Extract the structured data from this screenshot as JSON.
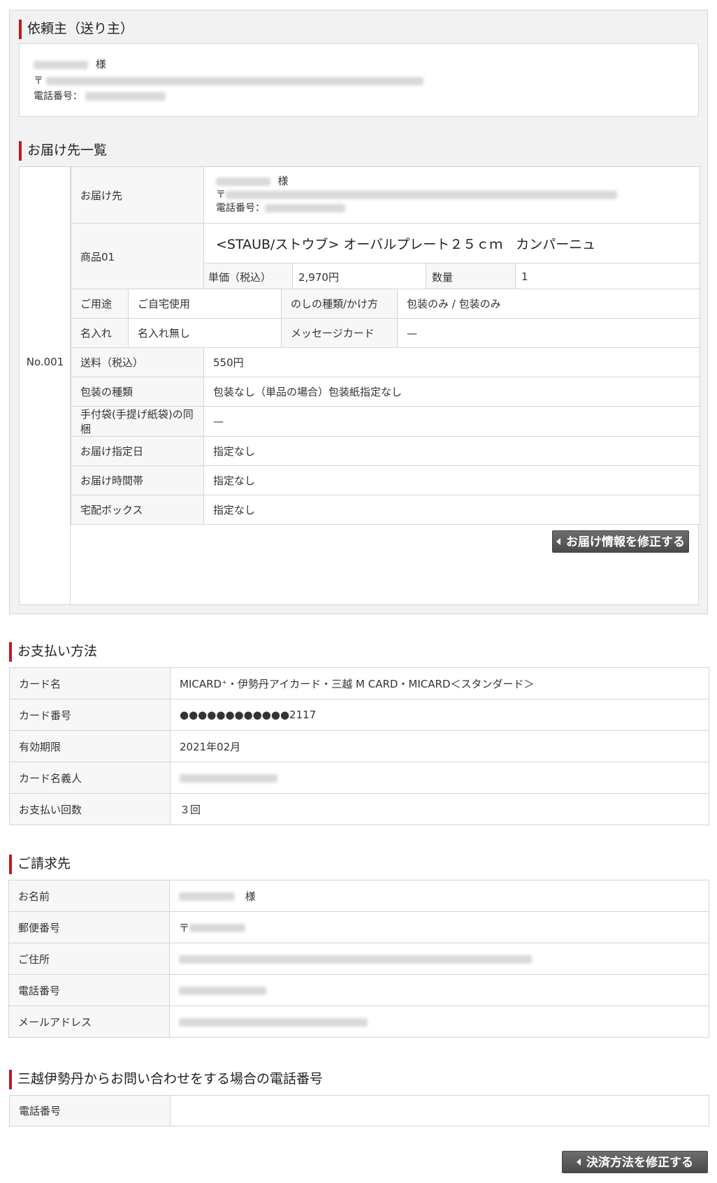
{
  "sender": {
    "title": "依頼主（送り主）",
    "honorific": "様",
    "postal_mark": "〒",
    "phone_label": "電話番号："
  },
  "destinations": {
    "title": "お届け先一覧",
    "number": "No.001",
    "recipient_label": "お届け先",
    "recipient_honorific": "様",
    "recipient_postal_mark": "〒",
    "recipient_phone_label": "電話番号：",
    "product_label": "商品01",
    "product_name": "<STAUB/ストウブ> オーバルプレート２５ｃｍ　カンパーニュ",
    "unit_price_label": "単価（税込）",
    "unit_price": "2,970円",
    "quantity_label": "数量",
    "quantity": "1",
    "usage_label": "ご用途",
    "usage": "ご自宅使用",
    "noshi_label": "のしの種類/かけ方",
    "noshi": "包装のみ / 包装のみ",
    "name_label": "名入れ",
    "name_value": "名入れ無し",
    "message_label": "メッセージカード",
    "message_value": "—",
    "rows": [
      {
        "label": "送料（税込）",
        "value": "550円"
      },
      {
        "label": "包装の種類",
        "value": "包装なし（単品の場合）包装紙指定なし"
      },
      {
        "label": "手付袋(手提げ紙袋)の同梱",
        "value": "—"
      },
      {
        "label": "お届け指定日",
        "value": "指定なし"
      },
      {
        "label": "お届け時間帯",
        "value": "指定なし"
      },
      {
        "label": "宅配ボックス",
        "value": "指定なし"
      }
    ],
    "edit_button": "お届け情報を修正する"
  },
  "payment": {
    "title": "お支払い方法",
    "card_name_label": "カード名",
    "card_name": "MICARD⁺・伊勢丹アイカード・三越 M CARD・MICARD＜スタンダード＞",
    "card_number_label": "カード番号",
    "card_number": "●●●●●●●●●●●●2117",
    "expiry_label": "有効期限",
    "expiry": "2021年02月",
    "holder_label": "カード名義人",
    "installments_label": "お支払い回数",
    "installments": "３回"
  },
  "billing": {
    "title": "ご請求先",
    "name_label": "お名前",
    "name_honorific": "様",
    "postal_label": "郵便番号",
    "postal_mark": "〒",
    "address_label": "ご住所",
    "phone_label": "電話番号",
    "email_label": "メールアドレス"
  },
  "contact": {
    "title": "三越伊勢丹からお問い合わせをする場合の電話番号",
    "phone_label": "電話番号"
  },
  "footer": {
    "edit_payment_button": "決済方法を修正する"
  }
}
